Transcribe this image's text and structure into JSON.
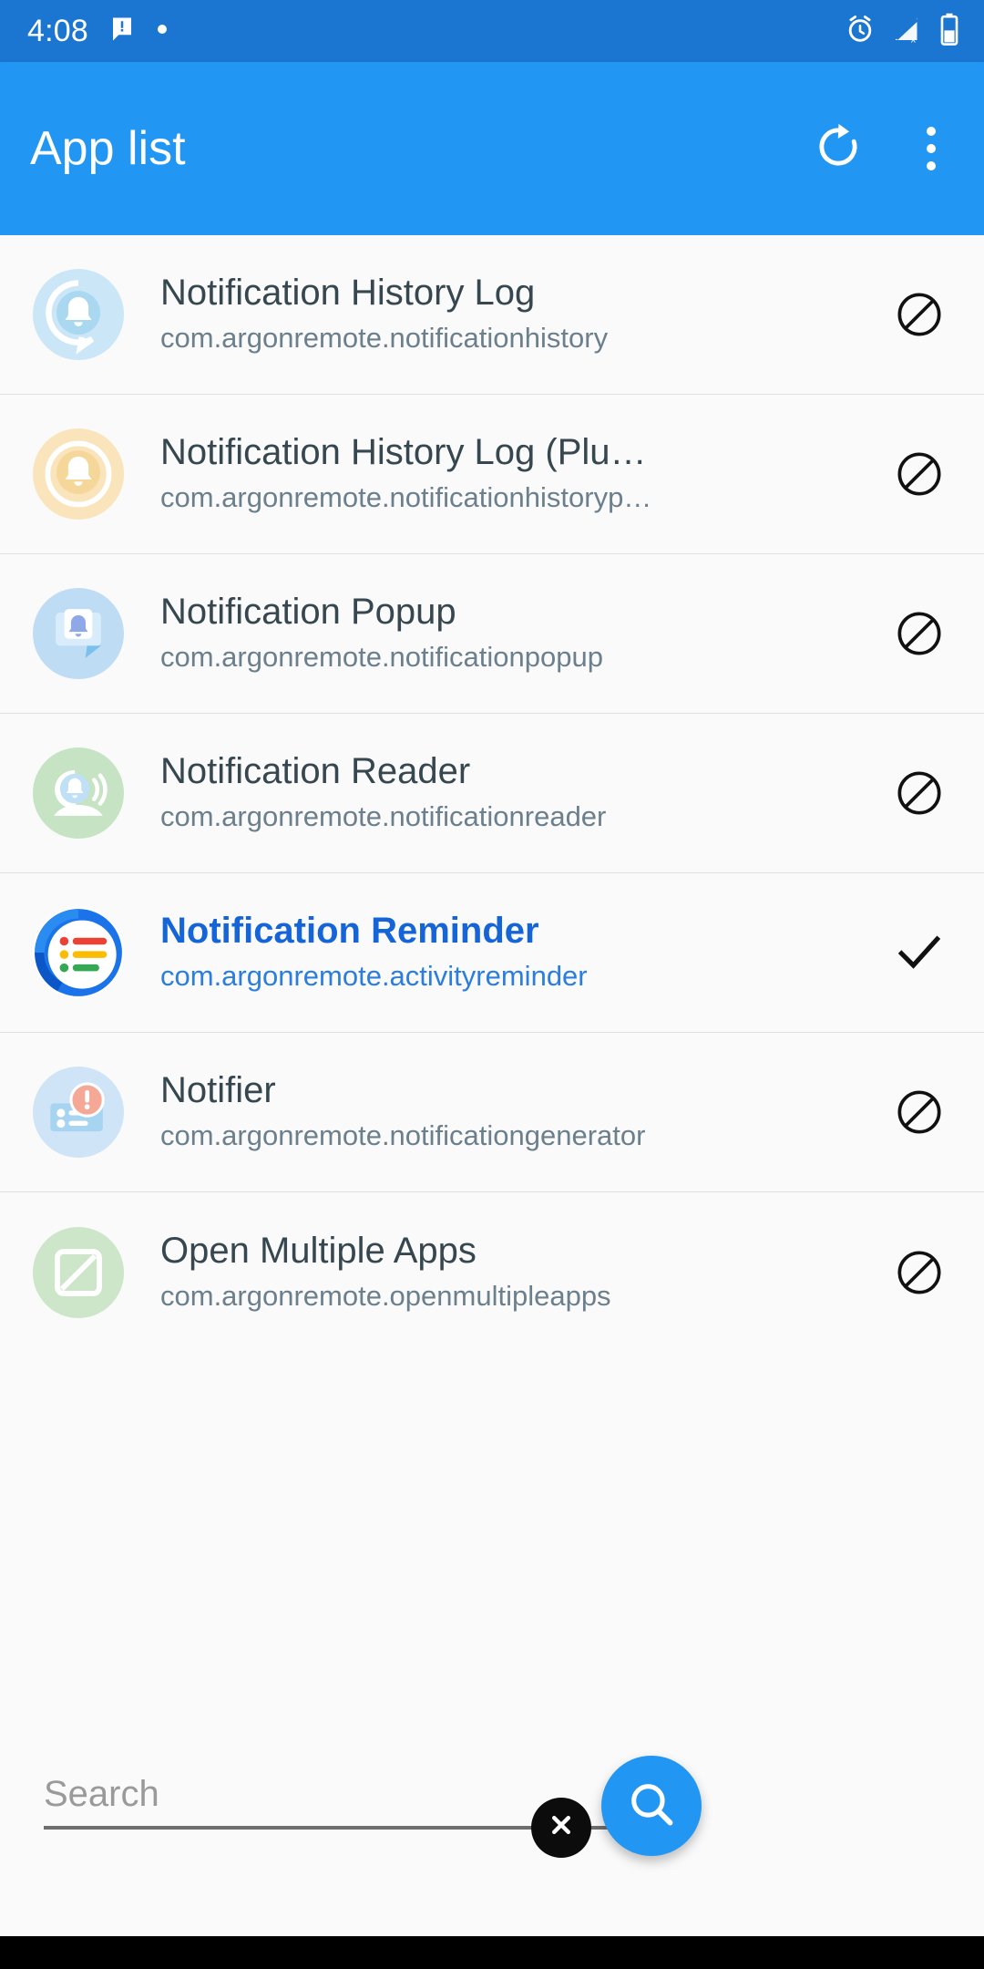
{
  "status_bar": {
    "time": "4:08",
    "left_icons": [
      "message-icon",
      "dot-icon"
    ],
    "right_icons": [
      "alarm-icon",
      "signal-off-icon",
      "battery-icon"
    ],
    "background": "#1b76d2"
  },
  "app_bar": {
    "title": "App list",
    "refresh_icon": "refresh-icon",
    "overflow_icon": "overflow-menu-icon",
    "background": "#2196f3"
  },
  "theme": {
    "accent": "#2196f3",
    "selected_text": "#1565d8",
    "title_color": "#37474f",
    "subtitle_color": "#6b7f8c",
    "list_background": "#fafafa",
    "divider": "#e0e0e0"
  },
  "list": {
    "items": [
      {
        "title": "Notification History Log",
        "package": "com.argonremote.notificationhistory",
        "status": "blocked",
        "status_icon": "block-icon",
        "selected": false,
        "icon": {
          "name": "bell-speech-bubble-icon",
          "bg": "#cbe7f7",
          "fg": "#ffffff"
        }
      },
      {
        "title": "Notification History Log (Plu…",
        "package": "com.argonremote.notificationhistoryp…",
        "status": "blocked",
        "status_icon": "block-icon",
        "selected": false,
        "icon": {
          "name": "bell-speech-bubble-plus-icon",
          "bg": "#fae4bb",
          "fg": "#ffffff"
        }
      },
      {
        "title": "Notification Popup",
        "package": "com.argonremote.notificationpopup",
        "status": "blocked",
        "status_icon": "block-icon",
        "selected": false,
        "icon": {
          "name": "bell-popup-icon",
          "bg": "#bfdcf5",
          "fg": "#ffffff"
        }
      },
      {
        "title": "Notification Reader",
        "package": "com.argonremote.notificationreader",
        "status": "blocked",
        "status_icon": "block-icon",
        "selected": false,
        "icon": {
          "name": "bell-sound-icon",
          "bg": "#c6e3c4",
          "fg": "#ffffff"
        }
      },
      {
        "title": "Notification Reminder",
        "package": "com.argonremote.activityreminder",
        "status": "checked",
        "status_icon": "check-icon",
        "selected": true,
        "icon": {
          "name": "checklist-circle-icon",
          "bg": "#ffffff",
          "fg": "#1a73e8"
        }
      },
      {
        "title": "Notifier",
        "package": "com.argonremote.notificationgenerator",
        "status": "blocked",
        "status_icon": "block-icon",
        "selected": false,
        "icon": {
          "name": "alert-card-icon",
          "bg": "#cfe4f7",
          "fg": "#f5a896"
        }
      },
      {
        "title": "Open Multiple Apps",
        "package": "com.argonremote.openmultipleapps",
        "status": "blocked",
        "status_icon": "block-icon",
        "selected": false,
        "icon": {
          "name": "slashed-square-icon",
          "bg": "#cde6c9",
          "fg": "#ffffff"
        }
      }
    ]
  },
  "search": {
    "value": "",
    "placeholder": "Search",
    "clear_icon": "clear-x-icon",
    "fab_icon": "search-icon",
    "fab_color": "#2196f3"
  }
}
